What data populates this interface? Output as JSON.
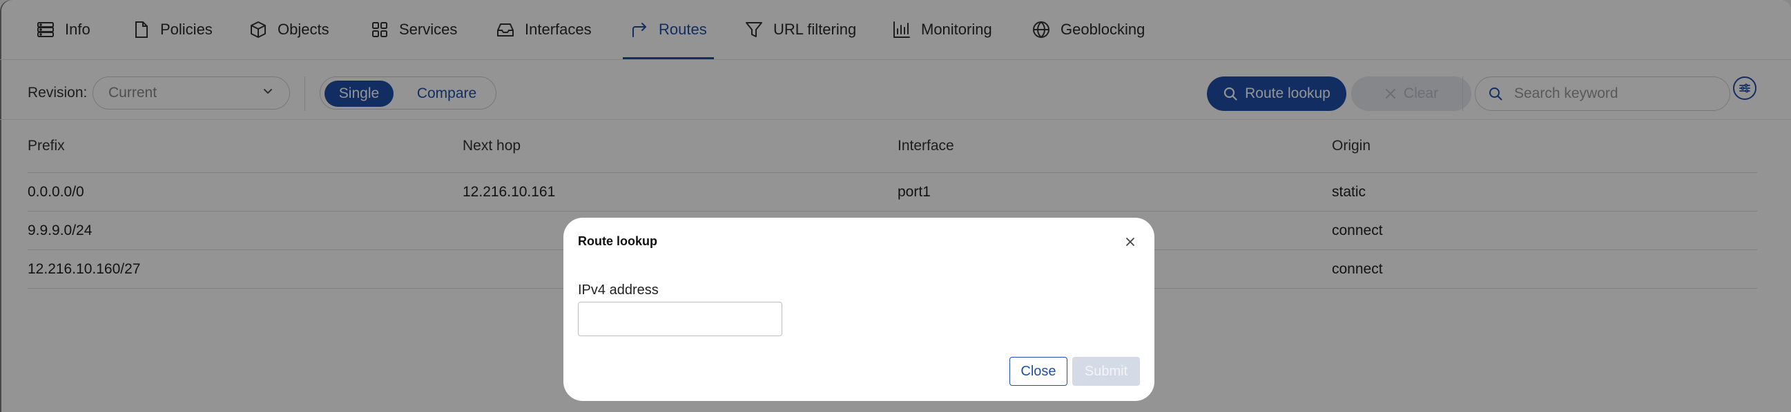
{
  "tabs": [
    {
      "label": "Info",
      "icon": "database-icon"
    },
    {
      "label": "Policies",
      "icon": "file-icon"
    },
    {
      "label": "Objects",
      "icon": "cube-icon"
    },
    {
      "label": "Services",
      "icon": "grid-icon"
    },
    {
      "label": "Interfaces",
      "icon": "inbox-icon"
    },
    {
      "label": "Routes",
      "icon": "route-arrow-icon",
      "active": true
    },
    {
      "label": "URL filtering",
      "icon": "funnel-icon"
    },
    {
      "label": "Monitoring",
      "icon": "bar-chart-icon"
    },
    {
      "label": "Geoblocking",
      "icon": "globe-icon"
    }
  ],
  "toolbar": {
    "revision_label": "Revision:",
    "revision_value": "Current",
    "mode_single": "Single",
    "mode_compare": "Compare",
    "route_lookup": "Route lookup",
    "clear": "Clear",
    "search_placeholder": "Search keyword"
  },
  "table": {
    "columns": [
      "Prefix",
      "Next hop",
      "Interface",
      "Origin"
    ],
    "rows": [
      [
        "0.0.0.0/0",
        "12.216.10.161",
        "port1",
        "static"
      ],
      [
        "9.9.9.0/24",
        "",
        "",
        "connect"
      ],
      [
        "12.216.10.160/27",
        "",
        "",
        "connect"
      ]
    ]
  },
  "modal": {
    "title": "Route lookup",
    "field_label": "IPv4 address",
    "field_value": "",
    "close_label": "Close",
    "submit_label": "Submit"
  },
  "colors": {
    "accent": "#1f4fa8",
    "overlay": "rgba(0,0,0,0.42)",
    "disabled_bg": "#d5dbe6"
  }
}
